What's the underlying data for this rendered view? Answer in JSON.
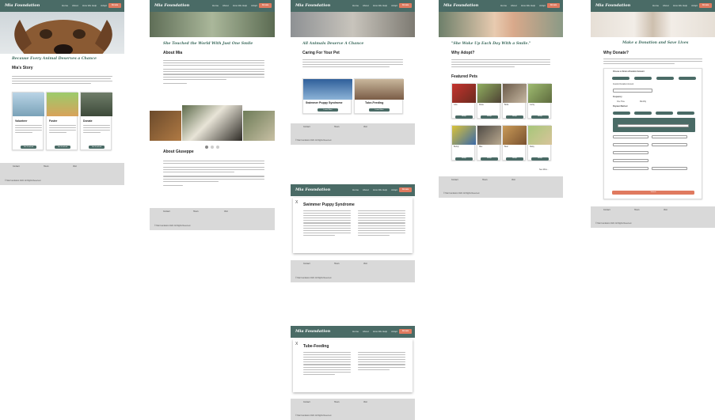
{
  "brand": {
    "logo": "Mia Foundation",
    "accent": "#e07a5f",
    "primary": "#4a6b66"
  },
  "nav": {
    "links": [
      "Home",
      "About",
      "How We Help",
      "Adopt"
    ],
    "donate": "Donate"
  },
  "home": {
    "tagline": "Because Every Animal Deserves a Chance",
    "story_title": "Mia's Story",
    "cards": [
      {
        "title": "Volunteer",
        "button": "Get Involved"
      },
      {
        "title": "Foster",
        "button": "Get Involved"
      },
      {
        "title": "Donate",
        "button": "Get Involved"
      }
    ]
  },
  "about": {
    "quote": "She Touched the World With Just One Smile",
    "about_mia": "About Mia",
    "about_giuseppe": "About Giuseppe"
  },
  "help": {
    "quote": "All Animals Deserve A Chance",
    "heading": "Caring For Your Pet",
    "cards": [
      {
        "title": "Swimmer Puppy Syndrome",
        "button": "Learn More"
      },
      {
        "title": "Tube-Feeding",
        "button": "Learn More"
      }
    ]
  },
  "modal1": {
    "close": "X",
    "title": "Swimmer Puppy Syndrome"
  },
  "modal2": {
    "close": "X",
    "title": "Tube-Feeding"
  },
  "adopt": {
    "quote": "\"She Woke Up Each Day With a Smile.\"",
    "why": "Why Adopt?",
    "featured": "Featured Pets",
    "pets_row1": [
      "Lola",
      "Rosie",
      "Bella",
      "Lucky"
    ],
    "pets_row2": [
      "Buddy",
      "Max",
      "Bear",
      "Daisy"
    ],
    "pet_button": "Adopt",
    "see_more": "See More..."
  },
  "donate": {
    "title": "Make a Donation and Save Lives",
    "why": "Why Donate?",
    "choose_amount": "Choose or Enter a Donation Amount",
    "custom_amount": "Custom Donation Amount",
    "frequency": "Frequency",
    "freq_options": [
      "One Time",
      "Monthly"
    ],
    "payment": "Payment Method",
    "submit": "Submit"
  },
  "footer": {
    "col1": "Contact",
    "col2": "Hours",
    "col3": "Visit",
    "copyright": "© Mia Foundation 2022. All Rights Reserved."
  }
}
